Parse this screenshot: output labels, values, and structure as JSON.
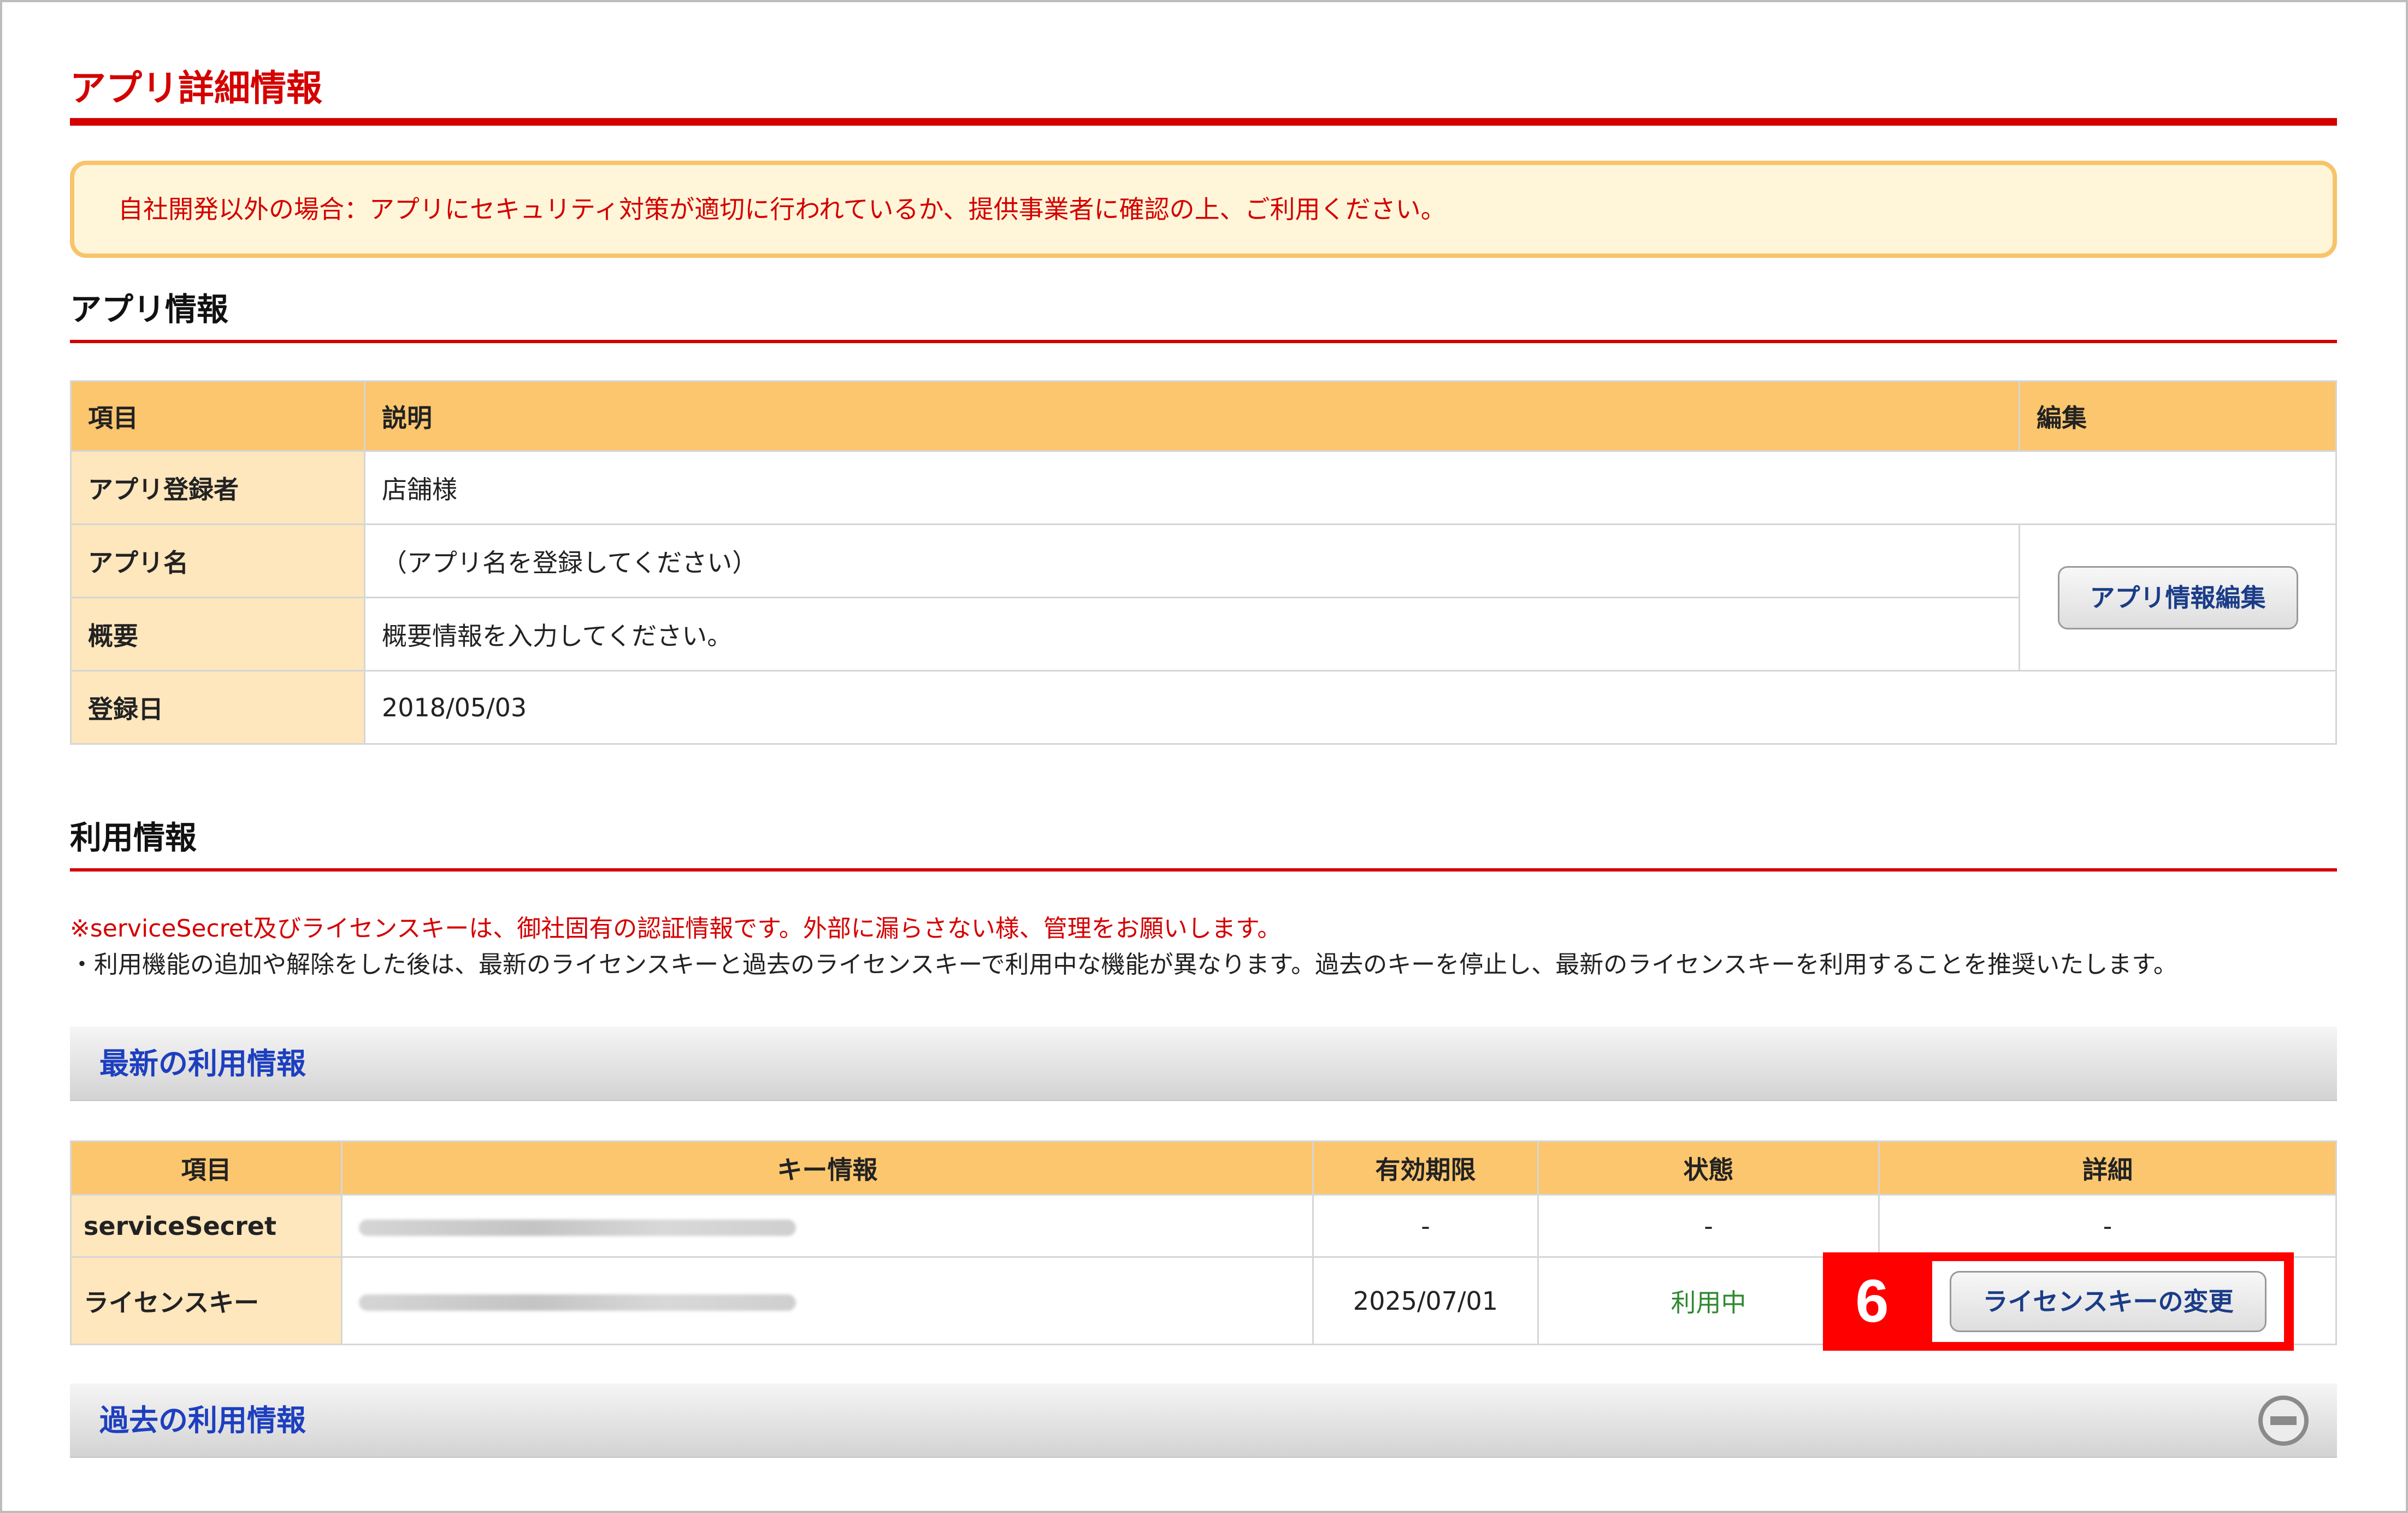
{
  "page": {
    "title": "アプリ詳細情報"
  },
  "notice": {
    "text": "自社開発以外の場合：アプリにセキュリティ対策が適切に行われているか、提供事業者に確認の上、ご利用ください。"
  },
  "app_info": {
    "heading": "アプリ情報",
    "columns": {
      "item": "項目",
      "description": "説明",
      "edit": "編集"
    },
    "rows": [
      {
        "label": "アプリ登録者",
        "value": "店舗様"
      },
      {
        "label": "アプリ名",
        "value": "（アプリ名を登録してください）"
      },
      {
        "label": "概要",
        "value": "概要情報を入力してください。"
      },
      {
        "label": "登録日",
        "value": "2018/05/03"
      }
    ],
    "edit_button": "アプリ情報編集"
  },
  "usage_info": {
    "heading": "利用情報",
    "warning": "※serviceSecret及びライセンスキーは、御社固有の認証情報です。外部に漏らさない様、管理をお願いします。",
    "note": "・利用機能の追加や解除をした後は、最新のライセンスキーと過去のライセンスキーで利用中な機能が異なります。過去のキーを停止し、最新のライセンスキーを利用することを推奨いたします。",
    "latest": {
      "title": "最新の利用情報",
      "columns": {
        "item": "項目",
        "key_info": "キー情報",
        "expiry": "有効期限",
        "status": "状態",
        "detail": "詳細"
      },
      "rows": [
        {
          "item": "serviceSecret",
          "expiry": "-",
          "status": "-",
          "detail": "-"
        },
        {
          "item": "ライセンスキー",
          "expiry": "2025/07/01",
          "status": "利用中"
        }
      ],
      "change_button": "ライセンスキーの変更",
      "step_number": "6"
    },
    "past": {
      "title": "過去の利用情報"
    }
  },
  "colors": {
    "accent_red": "#d40000",
    "header_orange": "#fbc66e",
    "label_cream": "#fee6bd",
    "link_blue": "#1d3fbf",
    "status_green": "#2f8a2f"
  },
  "icons": {
    "collapse": "minus-circle-icon"
  }
}
